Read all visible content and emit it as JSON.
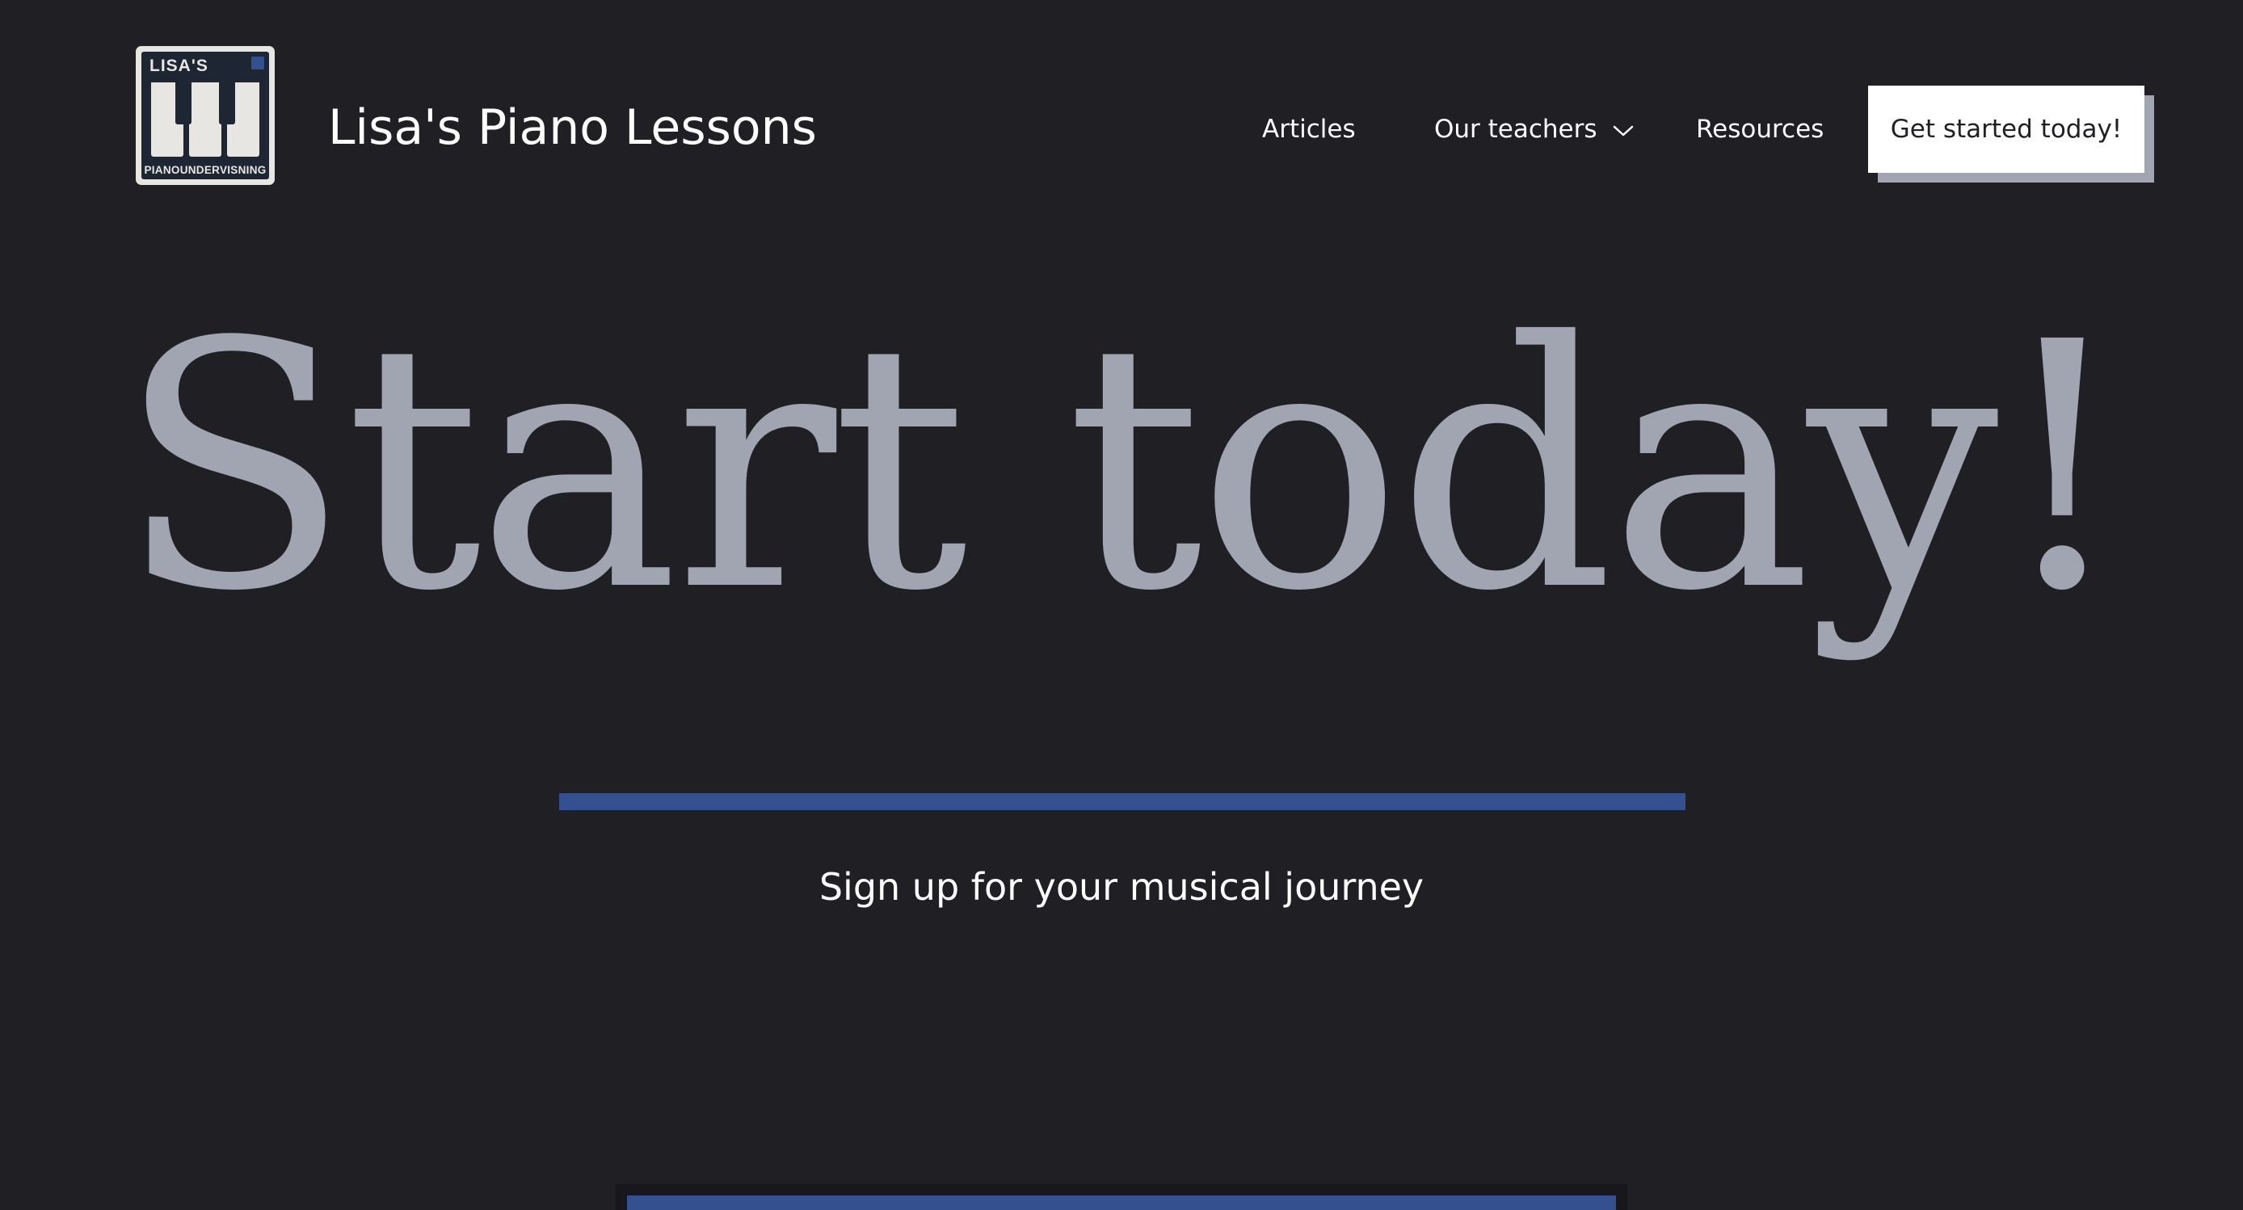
{
  "logo": {
    "top_text": "LISA'S",
    "bottom_text": "PIANOUNDERVISNING",
    "colors": {
      "frame": "#e8e6e3",
      "background": "#1e2633",
      "accent": "#34508e"
    }
  },
  "header": {
    "site_title": "Lisa's Piano Lessons",
    "nav": {
      "articles": "Articles",
      "teachers": "Our teachers",
      "teachers_icon": "chevron-down-icon",
      "resources": "Resources"
    },
    "cta_label": "Get started today!"
  },
  "hero": {
    "title": "Start today!",
    "subtitle": "Sign up for your musical journey"
  },
  "colors": {
    "page_background": "#1f1f24",
    "hero_title": "#a1a5b1",
    "accent_blue": "#34508e",
    "text": "#ffffff",
    "cta_background": "#ffffff",
    "cta_shadow": "#a1a5b1"
  }
}
